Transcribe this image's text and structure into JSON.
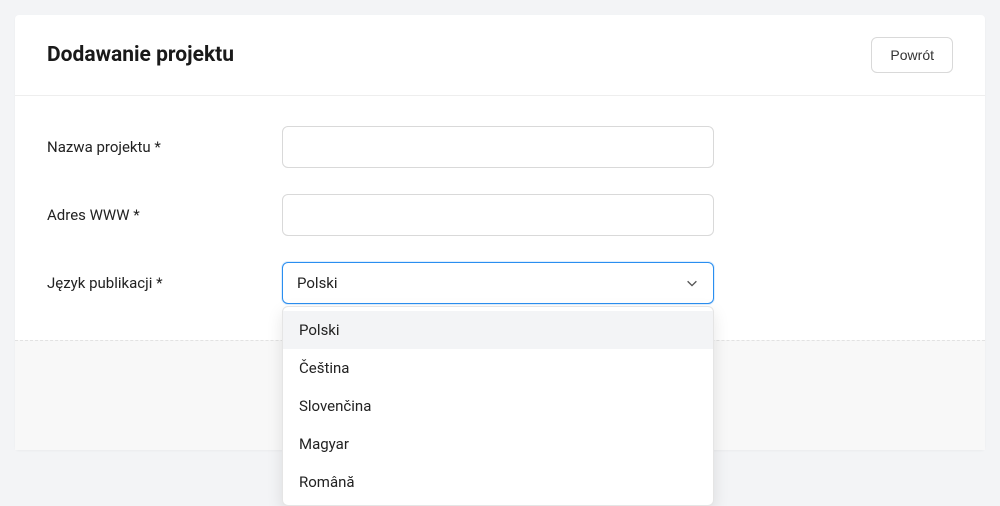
{
  "header": {
    "title": "Dodawanie projektu",
    "back_label": "Powrót"
  },
  "form": {
    "project_name": {
      "label": "Nazwa projektu *",
      "value": ""
    },
    "www_address": {
      "label": "Adres WWW *",
      "value": ""
    },
    "publication_language": {
      "label": "Język publikacji *",
      "selected": "Polski",
      "options": [
        "Polski",
        "Čeština",
        "Slovenčina",
        "Magyar",
        "Română"
      ],
      "highlighted_index": 0
    }
  }
}
